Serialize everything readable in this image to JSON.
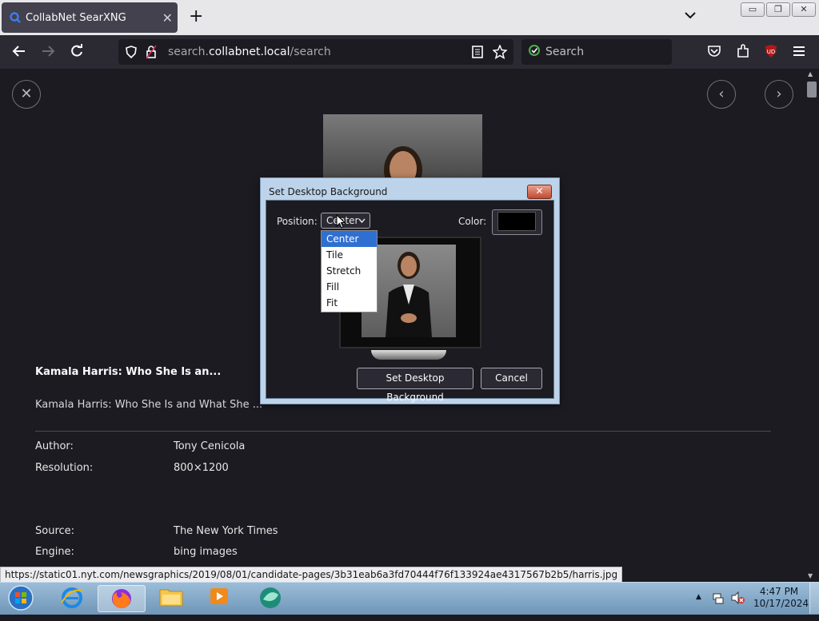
{
  "browser": {
    "tab_title": "CollabNet SearXNG",
    "url_prefix": "search.",
    "url_host": "collabnet.local",
    "url_path": "/search",
    "search_placeholder": "Search",
    "status_url": "https://static01.nyt.com/newsgraphics/2019/08/01/candidate-pages/3b31eab6a3fd70444f76f133924ae4317567b2b5/harris.jpg"
  },
  "result": {
    "title": "Kamala Harris: Who She Is an...",
    "description": "Kamala Harris: Who She Is and What She ...",
    "author_label": "Author:",
    "author": "Tony Cenicola",
    "resolution_label": "Resolution:",
    "resolution": "800×1200",
    "source_label": "Source:",
    "source": "The New York Times",
    "engine_label": "Engine:",
    "engine": "bing images"
  },
  "dialog": {
    "title": "Set Desktop Background",
    "position_label": "Position:",
    "position_value": "Center",
    "color_label": "Color:",
    "color_value": "#000000",
    "options": [
      "Center",
      "Tile",
      "Stretch",
      "Fill",
      "Fit"
    ],
    "set_button": "Set Desktop Background",
    "cancel_button": "Cancel"
  },
  "taskbar": {
    "time": "4:47 PM",
    "date": "10/17/2024"
  },
  "colors": {
    "accent": "#2f6fd1",
    "page_bg": "#1c1b22",
    "toolbar_bg": "#2b2a33"
  }
}
